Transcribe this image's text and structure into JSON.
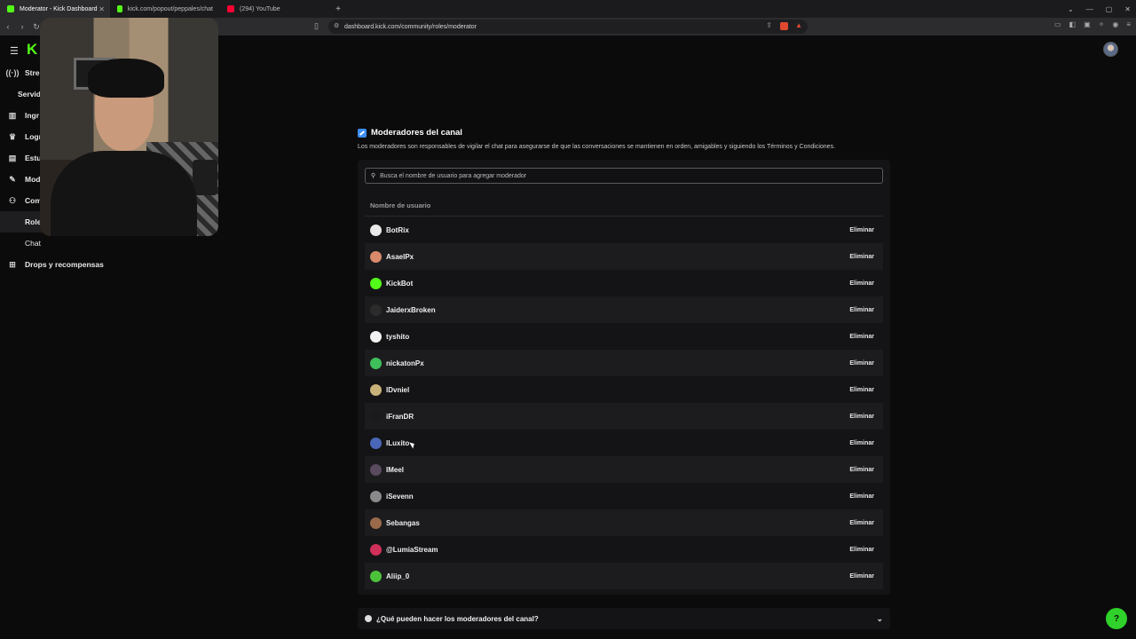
{
  "browser": {
    "tabs": [
      {
        "label": "Moderator - Kick Dashboard",
        "color": "#53fc18",
        "active": true
      },
      {
        "label": "kick.com/popout/peppales/chat",
        "color": "#53fc18",
        "active": false
      },
      {
        "label": "(294) YouTube",
        "color": "#ff0033",
        "active": false
      }
    ],
    "new_tab": "+",
    "url": "dashboard.kick.com/community/roles/moderator"
  },
  "sidebar": {
    "logo": "K",
    "items": [
      {
        "label": "Stre",
        "icon": "broadcast-icon"
      },
      {
        "label": "Servid",
        "icon": ""
      },
      {
        "label": "Ingr",
        "icon": "chart-icon"
      },
      {
        "label": "Logr",
        "icon": "trophy-icon"
      },
      {
        "label": "Estu",
        "icon": "studio-icon"
      },
      {
        "label": "Mod",
        "icon": "wrench-icon"
      },
      {
        "label": "Com",
        "icon": "community-icon"
      },
      {
        "label": "Roles",
        "icon": ""
      },
      {
        "label": "Chat",
        "icon": ""
      },
      {
        "label": "Drops y recompensas",
        "icon": "gift-icon"
      }
    ]
  },
  "main": {
    "title": "Moderadores del canal",
    "description": "Los moderadores son responsables de vigilar el chat para asegurarse de que las conversaciones se mantienen en orden, amigables y siguiendo los Términos y Condiciones.",
    "search_placeholder": "Busca el nombre de usuario para agregar moderador",
    "column_header": "Nombre de usuario",
    "remove_label": "Eliminar",
    "moderators": [
      {
        "name": "BotRix",
        "avatar_color": "#e9e9e9"
      },
      {
        "name": "AsaelPx",
        "avatar_color": "#d98a6a"
      },
      {
        "name": "KickBot",
        "avatar_color": "#53fc18"
      },
      {
        "name": "JaiderxBroken",
        "avatar_color": "#2b2b2b"
      },
      {
        "name": "tyshito",
        "avatar_color": "#f2f2f2"
      },
      {
        "name": "nickatonPx",
        "avatar_color": "#3fbf5a"
      },
      {
        "name": "lDvniel",
        "avatar_color": "#c9b27a"
      },
      {
        "name": "iFranDR",
        "avatar_color": "#1a1a1a"
      },
      {
        "name": "lLuxito",
        "avatar_color": "#4a66b8"
      },
      {
        "name": "IMeel",
        "avatar_color": "#5a4a5e"
      },
      {
        "name": "iSevenn",
        "avatar_color": "#8a8a8a"
      },
      {
        "name": "Sebangas",
        "avatar_color": "#9a6a4a"
      },
      {
        "name": "@LumiaStream",
        "avatar_color": "#d0305a"
      },
      {
        "name": "Aliip_0",
        "avatar_color": "#4cc23a"
      }
    ]
  },
  "faq": {
    "question": "¿Qué pueden hacer los moderadores del canal?"
  },
  "colors": {
    "accent": "#53fc18",
    "background": "#0b0b0c",
    "panel": "#141416"
  }
}
